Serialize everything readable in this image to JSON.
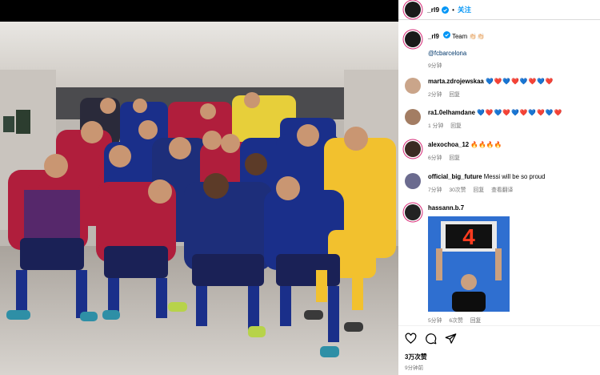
{
  "post": {
    "username": "_rl9",
    "follow_label": "关注",
    "dot": "•"
  },
  "caption": {
    "username": "_rl9",
    "text": "Team 👏🏻👏🏻",
    "mention": "@fcbarcelona",
    "time": "9分钟"
  },
  "comments": [
    {
      "username": "marta.zdrojewskaa",
      "text": "💙❤️💙❤️💙❤️💙❤️",
      "time": "2分钟",
      "reply": "回复",
      "replies": "",
      "avatar_color": "#caa58a"
    },
    {
      "username": "ra1.0elhamdane",
      "text": "💙❤️💙❤️💙❤️💙❤️💙❤️",
      "time": "1 分钟",
      "reply": "回复",
      "replies": "",
      "avatar_color": "#a37d63"
    },
    {
      "username": "alexochoa_12",
      "text": "🔥🔥🔥🔥",
      "time": "6分钟",
      "reply": "回复",
      "replies": "",
      "avatar_color": "#3b2a22"
    },
    {
      "username": "official_big_future",
      "text": "Messi will be so proud",
      "time": "7分钟",
      "reply": "回复",
      "replies": "30次赞",
      "view_replies": "查看翻译",
      "avatar_color": "#6b6b8f"
    },
    {
      "username": "hassann.b.7",
      "text": "",
      "time": "5分钟",
      "reply": "回复",
      "replies": "6次赞",
      "avatar_color": "#222"
    }
  ],
  "board_number": "4",
  "likes": "3万次赞",
  "post_time": "9分钟前",
  "icons": [
    "heart-icon",
    "comment-icon",
    "share-icon"
  ],
  "colors": {
    "accent": "#0095f6",
    "barca_blue": "#1a2f8a",
    "barca_red": "#b01e3c",
    "keeper_yellow": "#f2c12e"
  }
}
